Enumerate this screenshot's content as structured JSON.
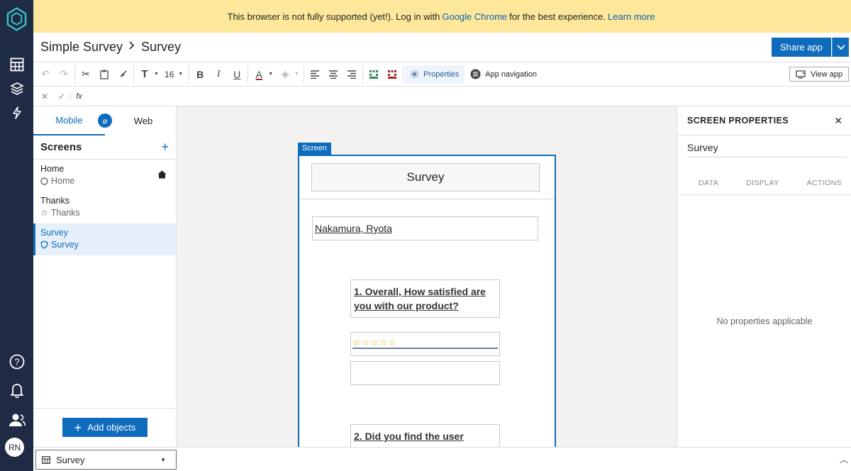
{
  "banner": {
    "text_before": "This browser is not fully supported (yet!). Log in with",
    "chrome_link": "Google Chrome",
    "text_after": "for the best experience.",
    "learn_more": "Learn more"
  },
  "header": {
    "app_name": "Simple Survey",
    "screen_name": "Survey",
    "share_label": "Share app"
  },
  "toolbar": {
    "font_size": "16",
    "properties_label": "Properties",
    "app_navigation_label": "App navigation",
    "view_app_label": "View app",
    "fx_label": "fx"
  },
  "left_panel": {
    "tab_mobile": "Mobile",
    "tab_web": "Web",
    "screens_title": "Screens",
    "screens": [
      {
        "name": "Home",
        "sub": "Home"
      },
      {
        "name": "Thanks",
        "sub": "Thanks"
      },
      {
        "name": "Survey",
        "sub": "Survey"
      }
    ],
    "add_objects_label": "Add objects"
  },
  "canvas": {
    "screen_tag": "Screen",
    "title": "Survey",
    "name_value": "Nakamura, Ryota",
    "question1": "1. Overall, How satisfied are you with our product?",
    "stars": "☆☆☆☆☆",
    "question2": "2. Did you find the user"
  },
  "right_panel": {
    "title": "SCREEN PROPERTIES",
    "screen_name": "Survey",
    "tabs": [
      "DATA",
      "DISPLAY",
      "ACTIONS"
    ],
    "empty_message": "No properties applicable"
  },
  "bottom_bar": {
    "selected_screen": "Survey"
  },
  "user": {
    "initials": "RN"
  },
  "colors": {
    "accent": "#0f6cbd",
    "rail": "#1f2a44",
    "banner": "#fce79a"
  }
}
